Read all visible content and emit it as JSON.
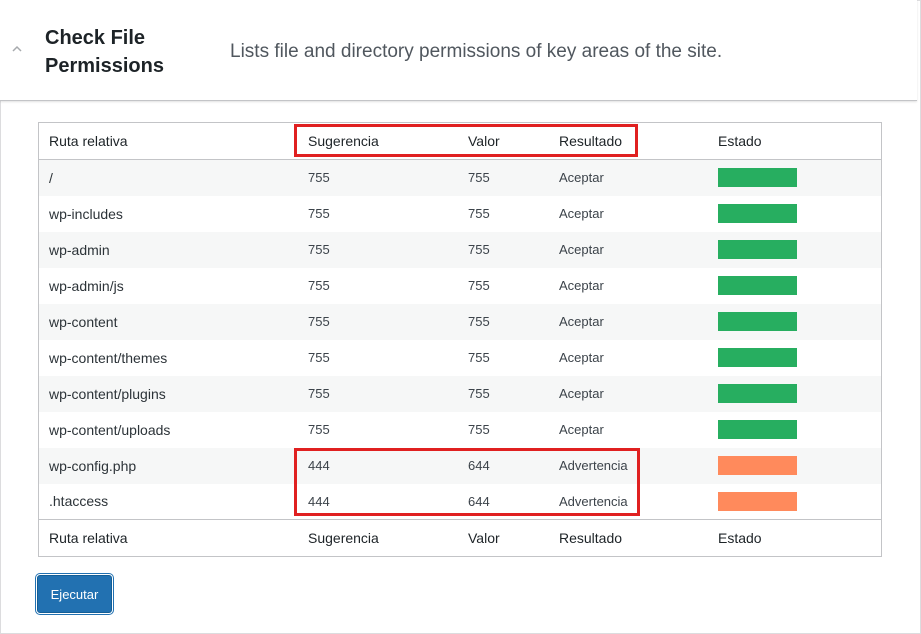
{
  "panel": {
    "title": "Check File Permissions",
    "description": "Lists file and directory permissions of key areas of the site."
  },
  "table": {
    "columns": [
      "Ruta relativa",
      "Sugerencia",
      "Valor",
      "Resultado",
      "Estado"
    ],
    "rows": [
      {
        "path": "/",
        "suggested": "755",
        "value": "755",
        "result": "Aceptar",
        "status": "ok"
      },
      {
        "path": "wp-includes",
        "suggested": "755",
        "value": "755",
        "result": "Aceptar",
        "status": "ok"
      },
      {
        "path": "wp-admin",
        "suggested": "755",
        "value": "755",
        "result": "Aceptar",
        "status": "ok"
      },
      {
        "path": "wp-admin/js",
        "suggested": "755",
        "value": "755",
        "result": "Aceptar",
        "status": "ok"
      },
      {
        "path": "wp-content",
        "suggested": "755",
        "value": "755",
        "result": "Aceptar",
        "status": "ok"
      },
      {
        "path": "wp-content/themes",
        "suggested": "755",
        "value": "755",
        "result": "Aceptar",
        "status": "ok"
      },
      {
        "path": "wp-content/plugins",
        "suggested": "755",
        "value": "755",
        "result": "Aceptar",
        "status": "ok"
      },
      {
        "path": "wp-content/uploads",
        "suggested": "755",
        "value": "755",
        "result": "Aceptar",
        "status": "ok"
      },
      {
        "path": "wp-config.php",
        "suggested": "444",
        "value": "644",
        "result": "Advertencia",
        "status": "warning"
      },
      {
        "path": ".htaccess",
        "suggested": "444",
        "value": "644",
        "result": "Advertencia",
        "status": "warning"
      }
    ]
  },
  "status_colors": {
    "ok": "#27ae60",
    "warning": "#ff8a5c"
  },
  "highlight_color": "#e02020",
  "actions": {
    "run_label": "Ejecutar"
  }
}
